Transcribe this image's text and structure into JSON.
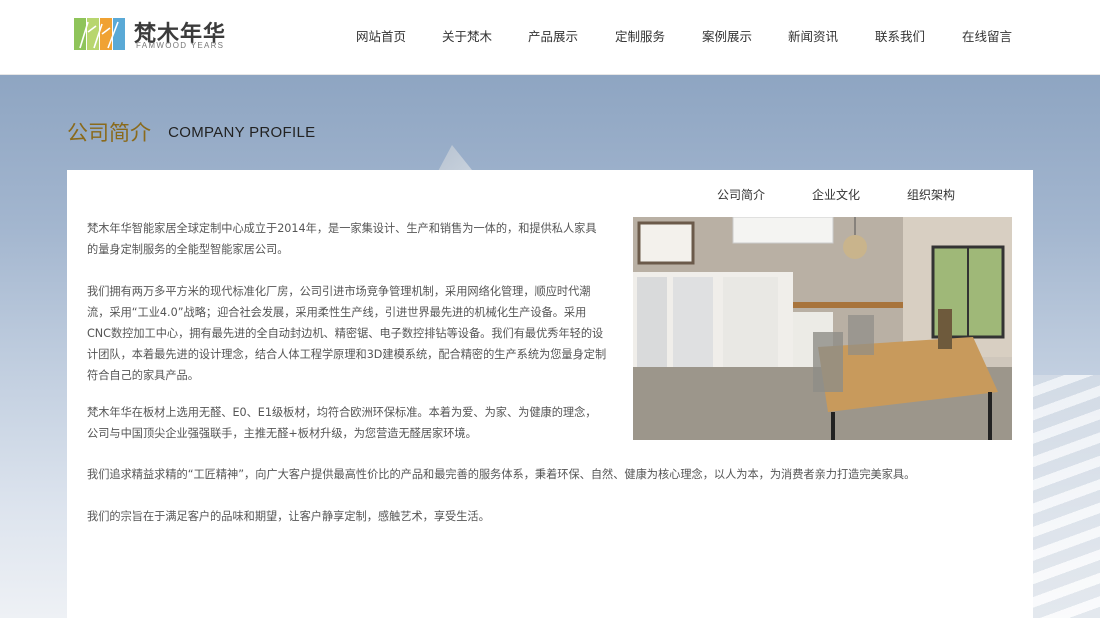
{
  "brand": {
    "name_cn": "梵木年华",
    "name_en": "FAMWOOD YEARS"
  },
  "nav": {
    "items": [
      "网站首页",
      "关于梵木",
      "产品展示",
      "定制服务",
      "案例展示",
      "新闻资讯",
      "联系我们",
      "在线留言"
    ]
  },
  "section": {
    "title_cn": "公司简介",
    "title_en": "COMPANY PROFILE"
  },
  "subnav": {
    "items": [
      "公司简介",
      "企业文化",
      "组织架构"
    ]
  },
  "content": {
    "paragraphs": [
      "梵木年华智能家居全球定制中心成立于2014年，是一家集设计、生产和销售为一体的，和提供私人家具的量身定制服务的全能型智能家居公司。",
      "我们拥有两万多平方米的现代标准化厂房，公司引进市场竞争管理机制，采用网络化管理，顺应时代潮流，采用“工业4.0”战略；迎合社会发展，采用柔性生产线，引进世界最先进的机械化生产设备。采用CNC数控加工中心，拥有最先进的全自动封边机、精密锯、电子数控排钻等设备。我们有最优秀年轻的设计团队，本着最先进的设计理念，结合人体工程学原理和3D建模系统，配合精密的生产系统为您量身定制符合自己的家具产品。",
      "梵木年华在板材上选用无醛、E0、E1级板材，均符合欧洲环保标准。本着为爱、为家、为健康的理念，公司与中国顶尖企业强强联手，主推无醛+板材升级，为您营造无醛居家环境。",
      "我们追求精益求精的“工匠精神”，向广大客户提供最高性价比的产品和最完善的服务体系，秉着环保、自然、健康为核心理念，以人为本，为消费者亲力打造完美家具。",
      "我们的宗旨在于满足客户的品味和期望，让客户静享定制，感触艺术，享受生活。"
    ]
  },
  "colors": {
    "title_gold": "#8a6a1b",
    "logo_green": "#8fc45a",
    "logo_orange": "#f0a233",
    "logo_blue": "#5aa9d6"
  }
}
